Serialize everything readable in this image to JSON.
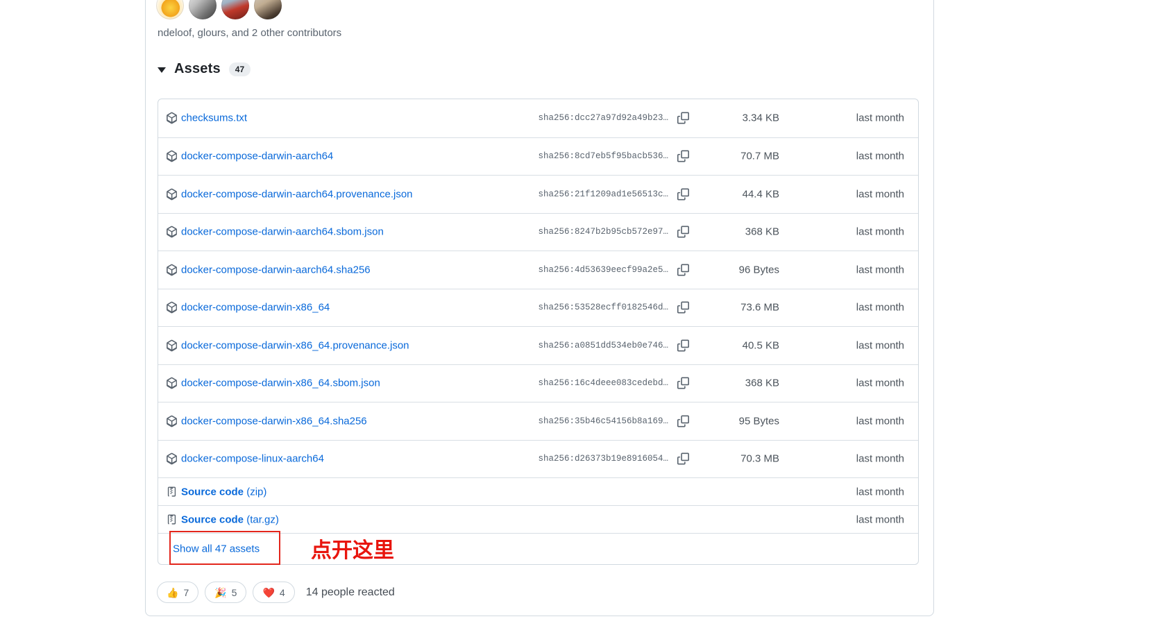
{
  "contributors": {
    "text": "ndeloof, glours, and 2 other contributors",
    "avatar_count": 4
  },
  "assets_section": {
    "title": "Assets",
    "count": "47",
    "caret_icon": "caret-down-icon"
  },
  "assets_table": {
    "asset_icon": "package-icon",
    "copy_icon": "copy-icon",
    "source_icon": "file-zip-icon",
    "rows": [
      {
        "name": "checksums.txt",
        "hash": "sha256:dcc27a97d92a49b23…",
        "size": "3.34 KB",
        "date": "last month"
      },
      {
        "name": "docker-compose-darwin-aarch64",
        "hash": "sha256:8cd7eb5f95bacb536…",
        "size": "70.7 MB",
        "date": "last month"
      },
      {
        "name": "docker-compose-darwin-aarch64.provenance.json",
        "hash": "sha256:21f1209ad1e56513c…",
        "size": "44.4 KB",
        "date": "last month"
      },
      {
        "name": "docker-compose-darwin-aarch64.sbom.json",
        "hash": "sha256:8247b2b95cb572e97…",
        "size": "368 KB",
        "date": "last month"
      },
      {
        "name": "docker-compose-darwin-aarch64.sha256",
        "hash": "sha256:4d53639eecf99a2e5…",
        "size": "96 Bytes",
        "date": "last month"
      },
      {
        "name": "docker-compose-darwin-x86_64",
        "hash": "sha256:53528ecff0182546d…",
        "size": "73.6 MB",
        "date": "last month"
      },
      {
        "name": "docker-compose-darwin-x86_64.provenance.json",
        "hash": "sha256:a0851dd534eb0e746…",
        "size": "40.5 KB",
        "date": "last month"
      },
      {
        "name": "docker-compose-darwin-x86_64.sbom.json",
        "hash": "sha256:16c4deee083cedebd…",
        "size": "368 KB",
        "date": "last month"
      },
      {
        "name": "docker-compose-darwin-x86_64.sha256",
        "hash": "sha256:35b46c54156b8a169…",
        "size": "95 Bytes",
        "date": "last month"
      },
      {
        "name": "docker-compose-linux-aarch64",
        "hash": "sha256:d26373b19e8916054…",
        "size": "70.3 MB",
        "date": "last month"
      }
    ],
    "source_rows": [
      {
        "label": "Source code",
        "format": "(zip)",
        "date": "last month"
      },
      {
        "label": "Source code",
        "format": "(tar.gz)",
        "date": "last month"
      }
    ],
    "show_all_label": "Show all 47 assets"
  },
  "annotation": {
    "text": "点开这里",
    "color": "#e8150d",
    "box_color": "#e3261c"
  },
  "reactions": {
    "items": [
      {
        "icon": "thumbs-up-emoji",
        "glyph": "👍",
        "count": "7"
      },
      {
        "icon": "party-popper-emoji",
        "glyph": "🎉",
        "count": "5"
      },
      {
        "icon": "heart-emoji",
        "glyph": "❤️",
        "count": "4"
      }
    ],
    "summary": "14 people reacted"
  },
  "colors": {
    "link_blue": "#0969da",
    "border": "#d1d9e0",
    "muted_text": "#59636e",
    "dark_text": "#1f2328"
  }
}
